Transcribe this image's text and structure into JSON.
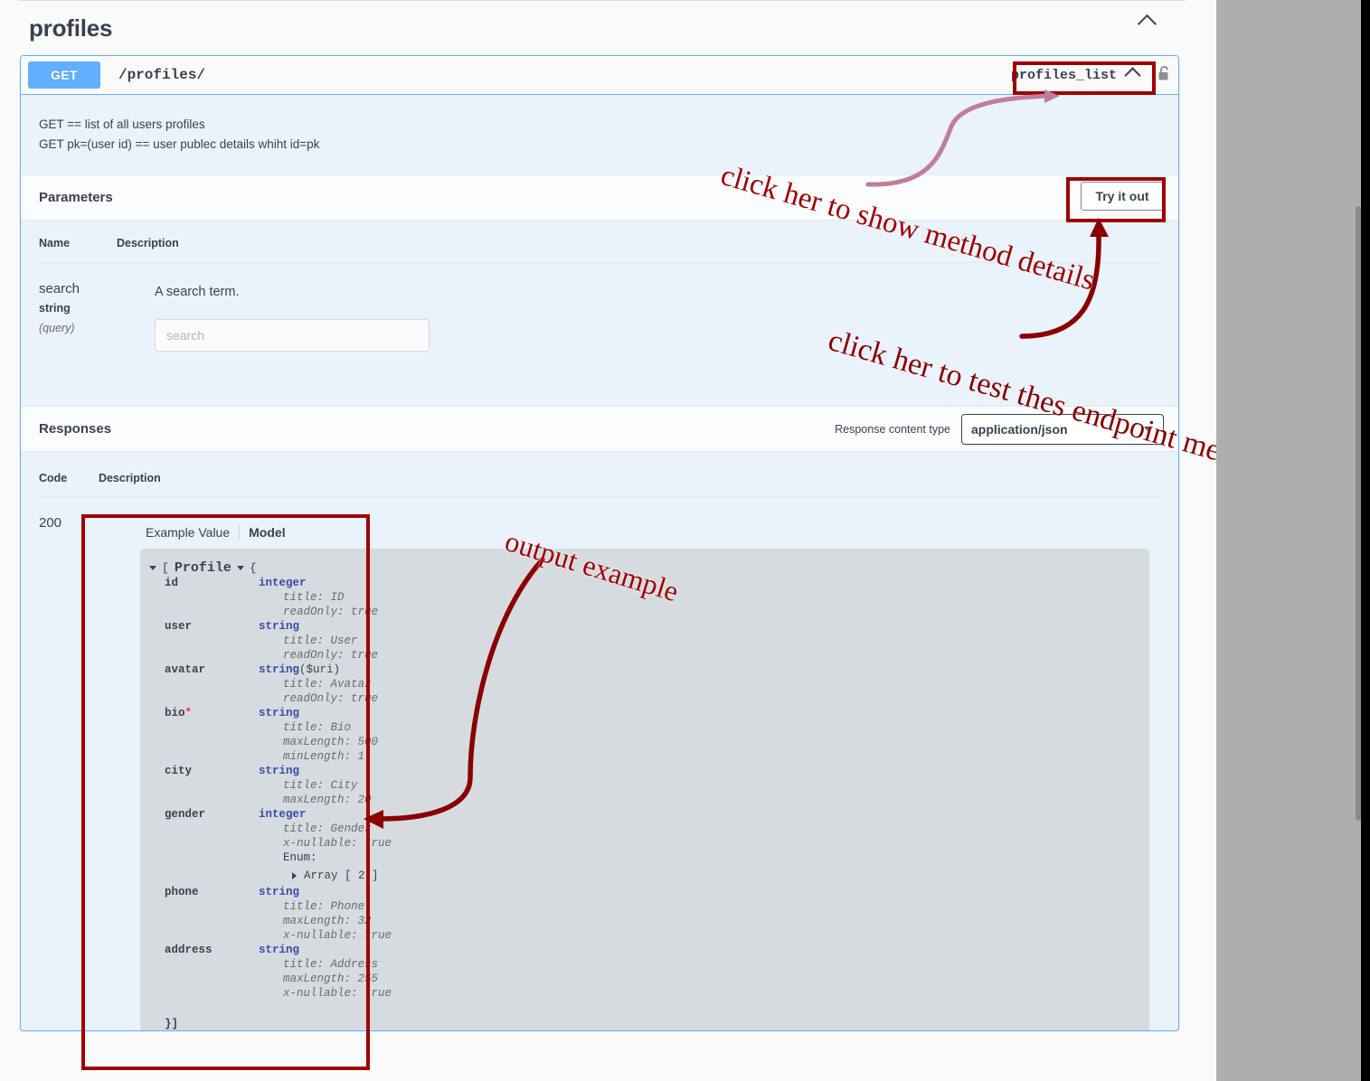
{
  "tag": {
    "name": "profiles",
    "collapse_icon": "chevron-up-icon"
  },
  "operation": {
    "method": "GET",
    "path": "/profiles/",
    "operation_id": "profiles_list",
    "operation_id_chevron": "chevron-up-icon",
    "auth_icon": "unlocked-padlock-icon",
    "description_line1": "GET == list of all users profiles",
    "description_line2": "GET pk=(user id) == user publec details whiht id=pk"
  },
  "parameters": {
    "section_title": "Parameters",
    "try_it_out_label": "Try it out",
    "headers": {
      "name": "Name",
      "description": "Description"
    },
    "rows": [
      {
        "name": "search",
        "type": "string",
        "in": "(query)",
        "description": "A search term.",
        "input_value": "",
        "input_placeholder": "search"
      }
    ]
  },
  "responses": {
    "section_title": "Responses",
    "content_type_label": "Response content type",
    "content_type_value": "application/json",
    "content_type_caret": "chevron-down-icon",
    "headers": {
      "code": "Code",
      "description": "Description"
    },
    "rows": [
      {
        "code": "200",
        "tabs": {
          "example_value": "Example Value",
          "model": "Model",
          "active": "Model"
        },
        "model": {
          "open_chevron": "chevron-down-icon",
          "open_bracket": "[",
          "title": "Profile",
          "title_chevron": "chevron-down-icon",
          "open_brace": "{",
          "close": "}]",
          "properties": [
            {
              "name": "id",
              "required": false,
              "type": "integer",
              "format": "",
              "attrs": [
                "title: ID",
                "readOnly: true"
              ]
            },
            {
              "name": "user",
              "required": false,
              "type": "string",
              "format": "",
              "attrs": [
                "title: User",
                "readOnly: true"
              ]
            },
            {
              "name": "avatar",
              "required": false,
              "type": "string",
              "format": "($uri)",
              "attrs": [
                "title: Avatar",
                "readOnly: true"
              ]
            },
            {
              "name": "bio",
              "required": true,
              "type": "string",
              "format": "",
              "attrs": [
                "title: Bio",
                "maxLength: 500",
                "minLength: 1"
              ]
            },
            {
              "name": "city",
              "required": false,
              "type": "string",
              "format": "",
              "attrs": [
                "title: City",
                "maxLength: 20"
              ]
            },
            {
              "name": "gender",
              "required": false,
              "type": "integer",
              "format": "",
              "attrs": [
                "title: Gender",
                "x-nullable: true"
              ],
              "enum_label": "Enum:",
              "enum_array": "Array [ 2 ]",
              "enum_chevron": "chevron-right-icon"
            },
            {
              "name": "phone",
              "required": false,
              "type": "string",
              "format": "",
              "attrs": [
                "title: Phone",
                "maxLength: 32",
                "x-nullable: true"
              ]
            },
            {
              "name": "address",
              "required": false,
              "type": "string",
              "format": "",
              "attrs": [
                "title: Address",
                "maxLength: 255",
                "x-nullable: true"
              ]
            }
          ]
        }
      }
    ]
  },
  "annotations": [
    {
      "text": "click her to show method details",
      "color": "#a00000"
    },
    {
      "text": "click her to test thes endpoint method",
      "color": "#8a0000"
    },
    {
      "text": "output example",
      "color": "#a00000"
    }
  ],
  "colors": {
    "get_method": "#61affe",
    "opblock_border": "#61affe",
    "opblock_bg": "#eaf2fb",
    "model_bg": "#d6dbe0",
    "annotation_red": "#a00000",
    "annotation_pink": "#c07d9b",
    "required_star": "#f93e3e",
    "type_blue": "#3b4ca8"
  }
}
